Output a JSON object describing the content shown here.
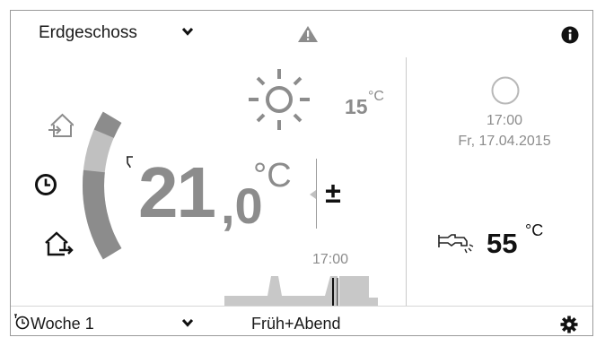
{
  "header": {
    "zone_label": "Erdgeschoss",
    "zone_chevron_icon": "chevron-down-icon",
    "warning_icon": "warning-triangle-icon",
    "info_icon": "info-circle-icon"
  },
  "modes": {
    "away_icon": "house-arrow-in-icon",
    "auto_icon": "clock-icon",
    "leave_icon": "house-arrow-out-icon"
  },
  "temperature": {
    "integer": "21",
    "decimal": ",0",
    "unit": "°C",
    "adjust_label": "±",
    "setpoint_level_percent": 60
  },
  "weather": {
    "icon": "sun-icon",
    "outside_temp": "15",
    "outside_unit": "°C"
  },
  "schedule_preview": {
    "time_label": "17:00"
  },
  "side_panel": {
    "status_icon": "circle-outline-icon",
    "time": "17:00",
    "date": "Fr, 17.04.2015",
    "hot_water_icon": "faucet-icon",
    "hot_water_temp": "55",
    "hot_water_unit": "°C"
  },
  "footer": {
    "program_icon": "clock-icon",
    "program_label": "Woche 1",
    "program_chevron_icon": "chevron-down-icon",
    "profile_label": "Früh+Abend",
    "settings_icon": "gear-icon"
  },
  "colors": {
    "arc_dark": "#8c8c8c",
    "arc_light": "#c0c0c0",
    "text_grey": "#8c8c8c",
    "schedule_fill": "#c8c8c8",
    "border": "#9a9a9a"
  }
}
